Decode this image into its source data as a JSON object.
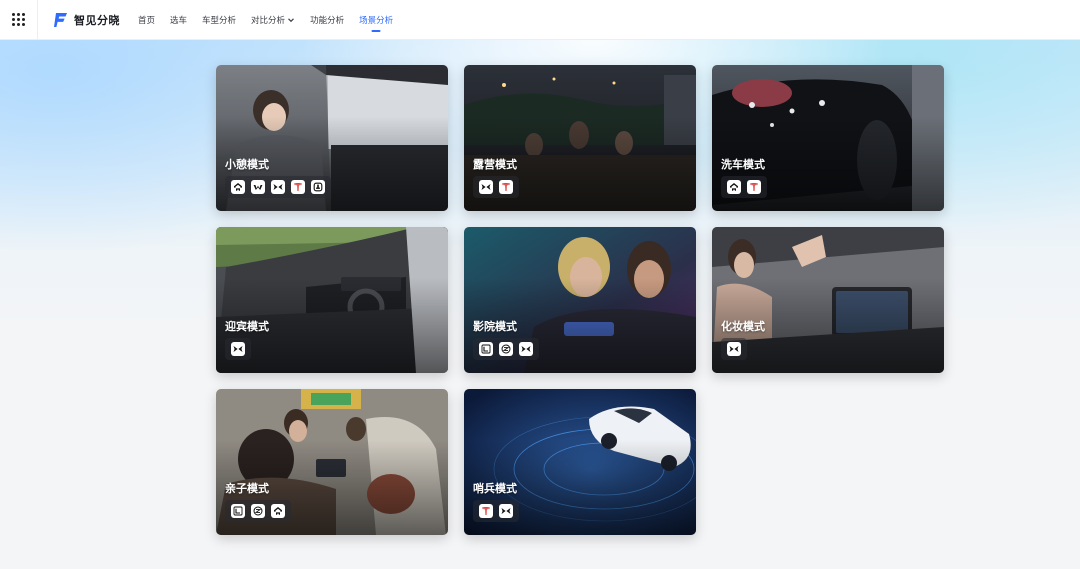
{
  "header": {
    "brand": "智见分晓",
    "nav": [
      {
        "label": "首页",
        "active": false
      },
      {
        "label": "选车",
        "active": false
      },
      {
        "label": "车型分析",
        "active": false
      },
      {
        "label": "对比分析",
        "active": false,
        "dropdown": true
      },
      {
        "label": "功能分析",
        "active": false
      },
      {
        "label": "场景分析",
        "active": true
      }
    ],
    "accent": "#2f6bff"
  },
  "scenes": [
    {
      "title": "小憩模式",
      "scene": "nap",
      "brands": [
        "nio",
        "vw",
        "xpeng",
        "tesla",
        "li"
      ]
    },
    {
      "title": "露营模式",
      "scene": "camping",
      "brands": [
        "xpeng",
        "tesla"
      ]
    },
    {
      "title": "洗车模式",
      "scene": "carwash",
      "brands": [
        "nio",
        "tesla"
      ]
    },
    {
      "title": "迎宾模式",
      "scene": "welcome",
      "brands": [
        "xpeng"
      ]
    },
    {
      "title": "影院模式",
      "scene": "cinema",
      "brands": [
        "lynk",
        "zeekr",
        "xpeng"
      ]
    },
    {
      "title": "化妆模式",
      "scene": "makeup",
      "brands": [
        "xpeng"
      ]
    },
    {
      "title": "亲子模式",
      "scene": "family",
      "brands": [
        "lynk",
        "zeekr",
        "nio"
      ]
    },
    {
      "title": "哨兵模式",
      "scene": "sentry",
      "brands": [
        "tesla",
        "xpeng"
      ]
    }
  ]
}
